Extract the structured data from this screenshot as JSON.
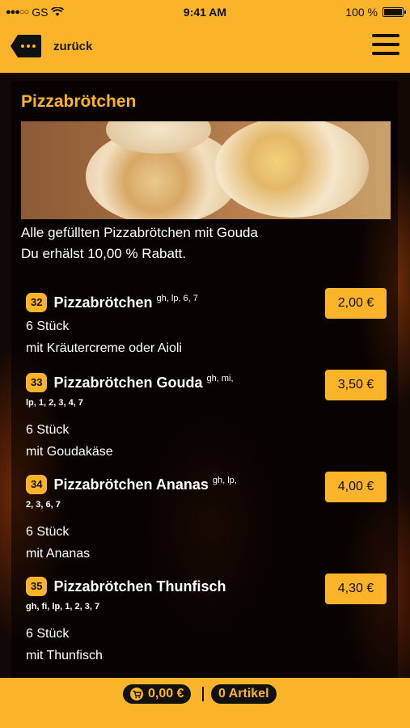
{
  "statusbar": {
    "carrier": "GS",
    "time": "9:41 AM",
    "battery": "100 %"
  },
  "nav": {
    "back_label": "zurück"
  },
  "section": {
    "title": "Pizzabrötchen",
    "desc_line1": "Alle gefüllten Pizzabrötchen mit Gouda",
    "desc_line2": "Du erhälst 10,00 % Rabatt."
  },
  "items": [
    {
      "number": "32",
      "name": "Pizzabrötchen",
      "allergens_inline": "gh, lp, 6, 7",
      "allergens_next": "",
      "qty": "6 Stück",
      "detail": "mit Kräutercreme oder Aioli",
      "price": "2,00 €"
    },
    {
      "number": "33",
      "name": "Pizzabrötchen Gouda",
      "allergens_inline": "gh, mi,",
      "allergens_next": "lp, 1, 2, 3, 4, 7",
      "qty": "6 Stück",
      "detail": "mit Goudakäse",
      "price": "3,50 €"
    },
    {
      "number": "34",
      "name": "Pizzabrötchen Ananas",
      "allergens_inline": "gh, lp,",
      "allergens_next": "2, 3, 6, 7",
      "qty": "6 Stück",
      "detail": "mit Ananas",
      "price": "4,00 €"
    },
    {
      "number": "35",
      "name": "Pizzabrötchen Thunfisch",
      "allergens_inline": "",
      "allergens_next": "gh, fi, lp, 1, 2, 3, 7",
      "qty": "6 Stück",
      "detail": "mit Thunfisch",
      "price": "4,30 €"
    }
  ],
  "cart": {
    "total": "0,00 €",
    "count": "0 Artikel"
  },
  "colors": {
    "accent": "#fbb42a",
    "dark": "#111111"
  }
}
